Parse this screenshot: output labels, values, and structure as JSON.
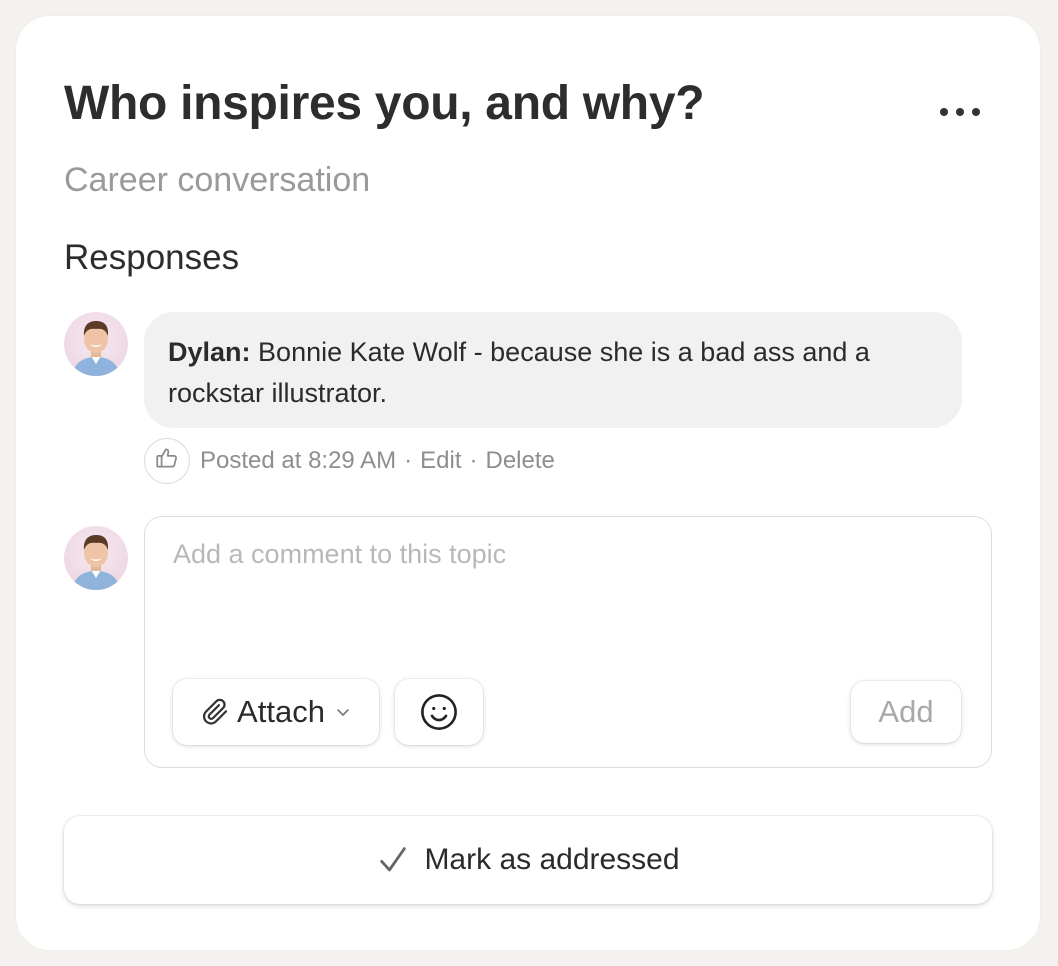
{
  "topic": {
    "title": "Who inspires you, and why?",
    "category": "Career conversation",
    "more_icon": "ellipsis-icon"
  },
  "responses": {
    "heading": "Responses",
    "items": [
      {
        "author": "Dylan:",
        "text": "Bonnie Kate Wolf - because she is a bad ass and a rockstar illustrator.",
        "posted": "Posted at 8:29 AM",
        "edit_label": "Edit",
        "delete_label": "Delete",
        "separator": "·",
        "like_icon": "thumbs-up-icon"
      }
    ]
  },
  "composer": {
    "placeholder": "Add a comment to this topic",
    "value": "",
    "attach_label": "Attach",
    "attach_icon": "paperclip-icon",
    "emoji_icon": "smiley-icon",
    "add_label": "Add"
  },
  "footer": {
    "mark_label": "Mark as addressed",
    "mark_icon": "checkmark-icon"
  },
  "colors": {
    "page_background": "#f3f2ee",
    "card_background": "#ffffff",
    "bubble_background": "#f1f1f1",
    "muted_text": "#9a9a9a",
    "primary_text": "#2b2b2b"
  }
}
